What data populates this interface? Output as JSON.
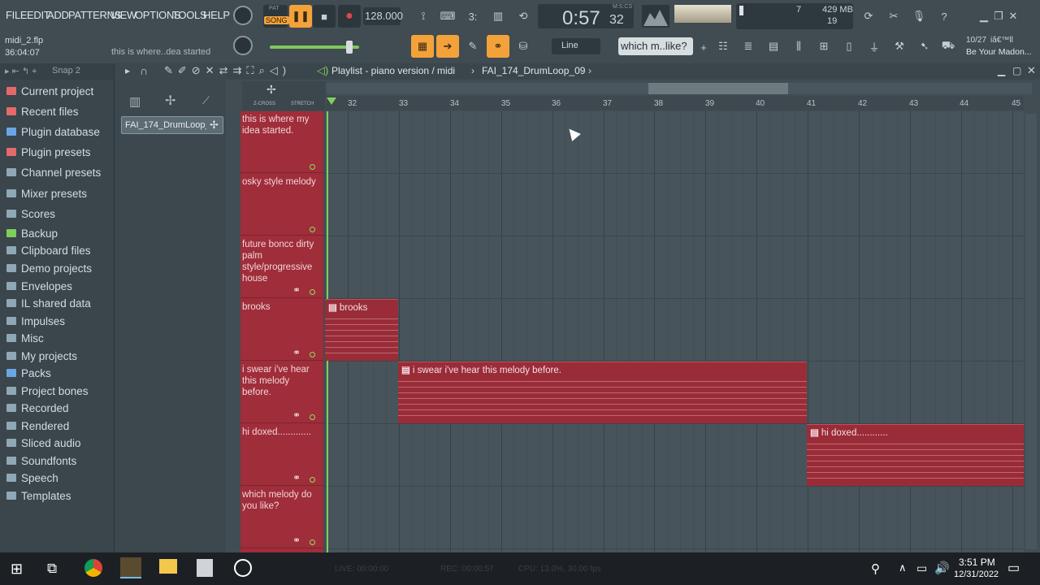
{
  "menu": [
    "FILE",
    "EDIT",
    "ADD",
    "PATTERNS",
    "VIEW",
    "OPTIONS",
    "TOOLS",
    "HELP"
  ],
  "transport": {
    "song_label": "SONG",
    "pat_label": "PAT",
    "tempo": "128.000",
    "time_main": "0:57",
    "time_sub": "32",
    "time_format": "M:S:CS"
  },
  "monitor": {
    "cpu_value": "7",
    "memory": "429 MB",
    "polyphony": "19"
  },
  "project": {
    "file": "midi_2.flp",
    "time": "36:04:07",
    "hint": "this is where..dea started"
  },
  "snap": "Snap 2",
  "line_mode": "Line",
  "pattern_selector": "which m..like?",
  "news": {
    "date": "10/27",
    "symbol": "iâ€™ll",
    "title": "Be Your Madon..."
  },
  "playlist_title": "Playlist - piano version / midi",
  "playlist_pattern": "FAI_174_DrumLoop_09",
  "channel_item": "FAI_174_DrumLoop_...",
  "toolbar_labels": {
    "zcross": "Z-CROSS",
    "stretch": "STRETCH"
  },
  "browser": [
    {
      "label": "Current project",
      "icon": "project-icon",
      "color": "#e46a6a"
    },
    {
      "label": "Recent files",
      "icon": "recent-icon",
      "color": "#e46a6a"
    },
    {
      "label": "Plugin database",
      "icon": "plugin-icon",
      "color": "#6aa6e4"
    },
    {
      "label": "Plugin presets",
      "icon": "preset-icon",
      "color": "#e46a6a"
    },
    {
      "label": "Channel presets",
      "icon": "folder-icon",
      "color": "#8fa8b6"
    },
    {
      "label": "Mixer presets",
      "icon": "mixer-icon",
      "color": "#8fa8b6"
    },
    {
      "label": "Scores",
      "icon": "note-icon",
      "color": "#8fa8b6"
    },
    {
      "label": "Backup",
      "icon": "backup-icon",
      "color": "#7ccf5a"
    },
    {
      "label": "Clipboard files",
      "icon": "folder-icon",
      "color": "#8fa8b6"
    },
    {
      "label": "Demo projects",
      "icon": "folder-icon",
      "color": "#8fa8b6"
    },
    {
      "label": "Envelopes",
      "icon": "folder-icon",
      "color": "#8fa8b6"
    },
    {
      "label": "IL shared data",
      "icon": "folder-icon",
      "color": "#8fa8b6"
    },
    {
      "label": "Impulses",
      "icon": "folder-icon",
      "color": "#8fa8b6"
    },
    {
      "label": "Misc",
      "icon": "folder-icon",
      "color": "#8fa8b6"
    },
    {
      "label": "My projects",
      "icon": "folder-icon",
      "color": "#8fa8b6"
    },
    {
      "label": "Packs",
      "icon": "packs-icon",
      "color": "#6aa6e4"
    },
    {
      "label": "Project bones",
      "icon": "folder-icon",
      "color": "#8fa8b6"
    },
    {
      "label": "Recorded",
      "icon": "folder-icon",
      "color": "#8fa8b6"
    },
    {
      "label": "Rendered",
      "icon": "folder-icon",
      "color": "#8fa8b6"
    },
    {
      "label": "Sliced audio",
      "icon": "folder-icon",
      "color": "#8fa8b6"
    },
    {
      "label": "Soundfonts",
      "icon": "folder-icon",
      "color": "#8fa8b6"
    },
    {
      "label": "Speech",
      "icon": "folder-icon",
      "color": "#8fa8b6"
    },
    {
      "label": "Templates",
      "icon": "folder-icon",
      "color": "#8fa8b6"
    }
  ],
  "ruler": [
    "32",
    "33",
    "34",
    "35",
    "36",
    "37",
    "38",
    "39",
    "40",
    "41",
    "42",
    "43",
    "44",
    "45"
  ],
  "tracks": [
    "this is where my idea started.",
    "osky style melody",
    "future boncc dirty palm style/progressive house",
    "brooks",
    "i swear i've hear this melody before.",
    "hi doxed.............",
    "which melody do you like?"
  ],
  "clips": [
    {
      "label": "brooks"
    },
    {
      "label": "i swear i've hear this melody before."
    },
    {
      "label": "hi doxed............"
    }
  ],
  "status": {
    "live": "LIVE: 00:00:00",
    "rec": "REC: 00:00:57",
    "cpu": "CPU: 13.0%, 30.00 fps"
  },
  "clock": {
    "time": "3:51 PM",
    "date": "12/31/2022"
  },
  "accent": "#f3a23a",
  "track_color": "#a02d3a"
}
